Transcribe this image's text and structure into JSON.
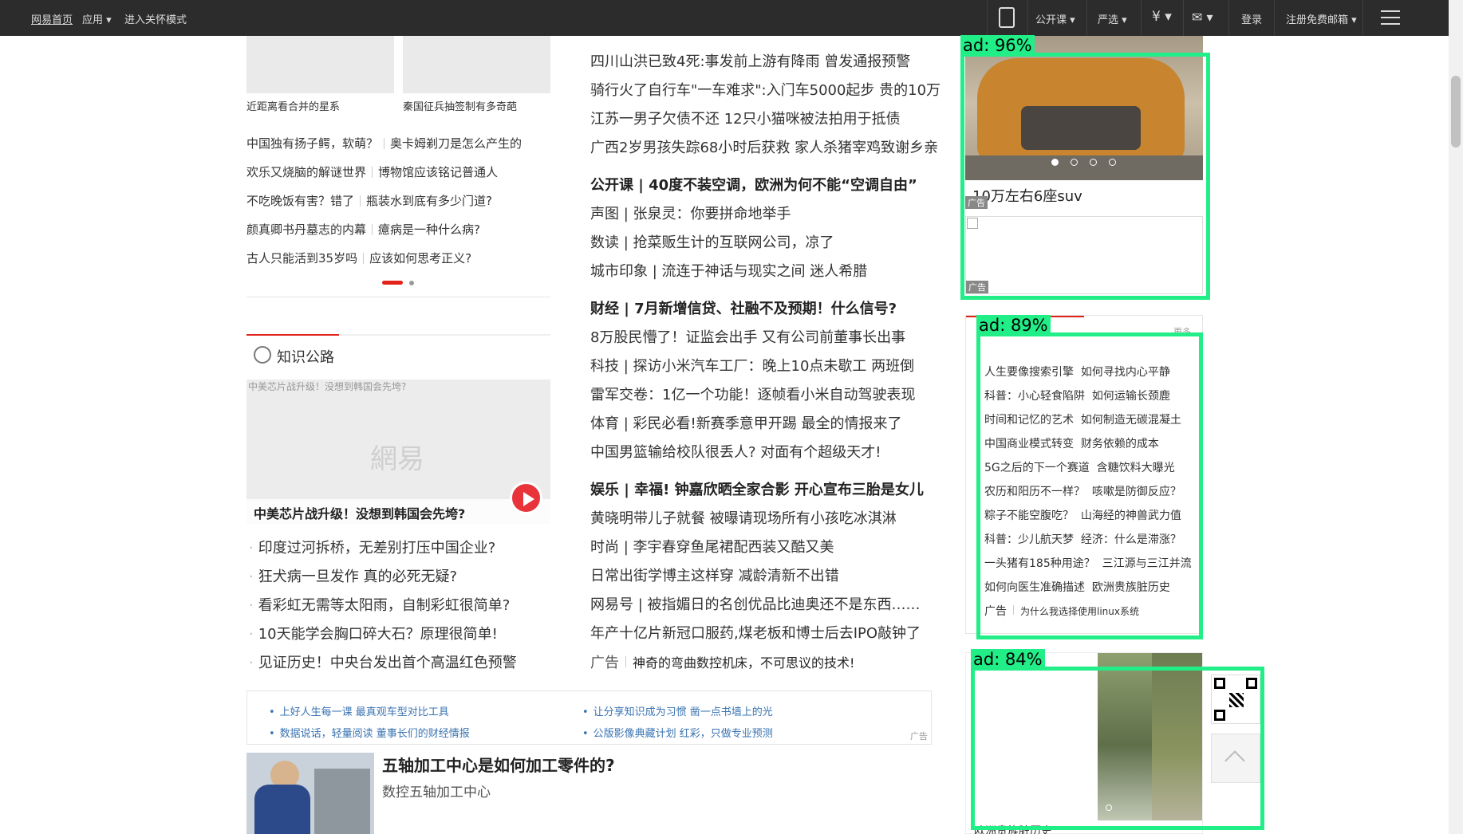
{
  "topbar": {
    "home": "网易首页",
    "apps": "应用",
    "care_mode": "进入关怀模式",
    "open_course": "公开课",
    "yanxuan": "严选",
    "login": "登录",
    "register_mail": "注册免费邮箱"
  },
  "left": {
    "thumb_captions": [
      "近距离看合并的星系",
      "秦国征兵抽签制有多奇葩"
    ],
    "pairs": [
      [
        "中国独有扬子鳄，软萌？",
        "奥卡姆剃刀是怎么产生的"
      ],
      [
        "欢乐又烧脑的解谜世界",
        "博物馆应该铭记普通人"
      ],
      [
        "不吃晚饭有害？错了",
        "瓶装水到底有多少门道?"
      ],
      [
        "颜真卿书丹墓志的内幕",
        "癔病是一种什么病?"
      ],
      [
        "古人只能活到35岁吗",
        "应该如何思考正义?"
      ]
    ],
    "knowledge_title": "知识公路",
    "video_broken_alt": "中美芯片战升级！没想到韩国会先垮?",
    "video_watermark": "網易",
    "video_caption": "中美芯片战升级！没想到韩国会先垮?",
    "knowledge_list": [
      "印度过河拆桥，无差别打压中国企业?",
      "狂犬病一旦发作 真的必死无疑?",
      "看彩虹无需等太阳雨，自制彩虹很简单?",
      "10天能学会胸口碎大石？原理很简单!",
      "见证历史！中央台发出首个高温红色预警"
    ]
  },
  "center": {
    "news": [
      {
        "text": "四川山洪已致4死:事发前上游有降雨 曾发通报预警",
        "bold": false
      },
      {
        "text": "骑行火了自行车\"一车难求\":入门车5000起步 贵的10万",
        "bold": false
      },
      {
        "text": "江苏一男子欠债不还 12只小猫咪被法拍用于抵债",
        "bold": false
      },
      {
        "text": "广西2岁男孩失踪68小时后获救 家人杀猪宰鸡致谢乡亲",
        "bold": false
      },
      {
        "text": "公开课 | 40度不装空调，欧洲为何不能“空调自由”",
        "bold": true
      },
      {
        "text": "声图 | 张泉灵：你要拼命地举手",
        "bold": false
      },
      {
        "text": "数读 | 抢菜贩生计的互联网公司，凉了",
        "bold": false
      },
      {
        "text": "城市印象 | 流连于神话与现实之间 迷人希腊",
        "bold": false
      },
      {
        "text": "财经 | 7月新增信贷、社融不及预期！什么信号?",
        "bold": true
      },
      {
        "text": "8万股民懵了！证监会出手 又有公司前董事长出事",
        "bold": false
      },
      {
        "text": "科技 | 探访小米汽车工厂：晚上10点未歇工 两班倒",
        "bold": false
      },
      {
        "text": "雷军交卷：1亿一个功能！逐帧看小米自动驾驶表现",
        "bold": false
      },
      {
        "text": "体育 | 彩民必看!新赛季意甲开踢 最全的情报来了",
        "bold": false
      },
      {
        "text": "中国男篮输给校队很丢人? 对面有个超级天才!",
        "bold": false
      },
      {
        "text": "娱乐 | 幸福! 钟嘉欣晒全家合影 开心宣布三胎是女儿",
        "bold": true
      },
      {
        "text": "黄晓明带儿子就餐 被曝请现场所有小孩吃冰淇淋",
        "bold": false
      },
      {
        "text": "时尚 | 李宇春穿鱼尾裙配西装又酷又美",
        "bold": false
      },
      {
        "text": "日常出街学博主这样穿 减龄清新不出错",
        "bold": false
      },
      {
        "text": "网易号 | 被指媚日的名创优品比迪奥还不是东西……",
        "bold": false
      },
      {
        "text": "年产十亿片新冠口服药,煤老板和博士后去IPO敲钟了",
        "bold": false
      }
    ],
    "ad_label": "广告",
    "ad_text": "神奇的弯曲数控机床，不可思议的技术!",
    "ad_links": [
      "上好人生每一课 最真观车型对比工具",
      "让分享知识成为习惯 凿一点书墙上的光",
      "数据说话，轻量阅读 董事长们的财经情报",
      "公版影像典藏计划 红彩，只做专业预测"
    ],
    "ad_corner": "广告",
    "promo_title": "五轴加工中心是如何加工零件的?",
    "promo_sub": "数控五轴加工中心"
  },
  "right": {
    "car_ad_text": "10万左右6座suv",
    "ad_tag": "广告",
    "more": "更多",
    "search_items": [
      [
        "人生要像搜索引擎",
        "如何寻找内心平静"
      ],
      [
        "科普：小心轻食陷阱",
        "如何运输长颈鹿"
      ],
      [
        "时间和记忆的艺术",
        "如何制造无碳混凝土"
      ],
      [
        "中国商业模式转变",
        "财务依赖的成本"
      ],
      [
        "5G之后的下一个赛道",
        "含糖饮料大曝光"
      ],
      [
        "农历和阳历不一样？",
        "咳嗽是防御反应？"
      ],
      [
        "粽子不能空腹吃？",
        "山海经的神兽武力值"
      ],
      [
        "科普：少儿航天梦",
        "经济：什么是滞涨？"
      ],
      [
        "一头猪有185种用途？",
        "三江源与三江并流"
      ],
      [
        "如何向医生准确描述",
        "欧洲贵族脏历史"
      ]
    ],
    "search_ad": "为什么我选择使用linux系统",
    "bottom_caption": "欧洲贵族脏历史"
  },
  "detections": [
    {
      "label": "ad: 96%"
    },
    {
      "label": "ad: 89%"
    },
    {
      "label": "ad: 84%"
    }
  ],
  "colors": {
    "accent": "#e2231a",
    "detector": "#22ee88",
    "topbar": "#2c2c2c"
  }
}
